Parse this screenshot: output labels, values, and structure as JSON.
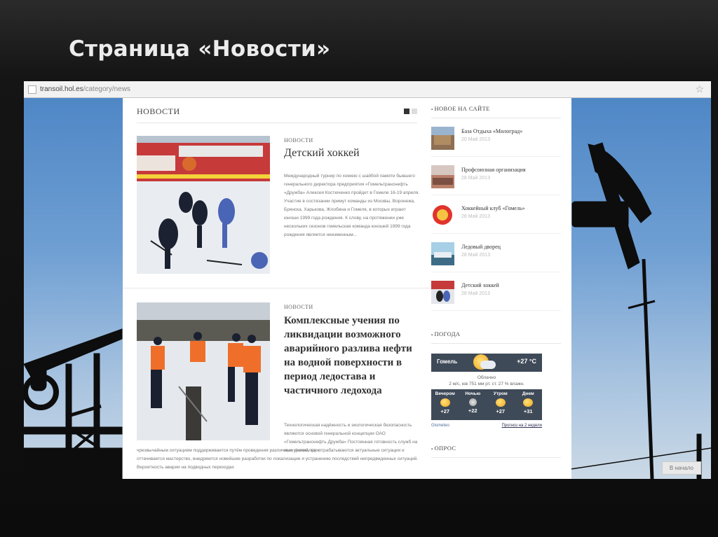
{
  "slide": {
    "title": "Страница «Новости»"
  },
  "browser": {
    "url_host": "transoil.hol.es",
    "url_path": "/category/news"
  },
  "page": {
    "section_title": "НОВОСТИ",
    "articles": [
      {
        "category": "НОВОСТИ",
        "title": "Детский хоккей",
        "excerpt": "Международный турнир по хоккею с шайбой памяти бывшего генерального директора предприятия «Гомельтранснефть «Дружба» Алексея Костюченко пройдет в Гомеле 16-19 апреля.  Участие в состязании примут команды из Москвы, Воронежа, Брянска, Харькова, Жлобина и Гомеля, в которых играют юноши 1999 года рождения. К слову, на протяжении уже нескольких сезонов гомельская команда юношей 1999 года рождения является неизменным..."
      },
      {
        "category": "НОВОСТИ",
        "title": "Комплексные учения по ликвидации возможного аварийного разлива нефти на водной поверхности в период ледостава и частичного ледохода",
        "excerpt": "Технологическая надёжность и экологическая безопасность являются основой генеральной концепции ОАО «Гомельтранснефть Дружба» Постоянная готовность служб на всех филиалах к",
        "excerpt_cont": "чрезвычайным ситуациям поддерживается путём проведения различных учений, где отрабатываются актуальные ситуации и оттачивается мастерство, внедряются новейшие разработки по локализации и устранению последствий непредвиденных ситуаций. Вероятность аварии на подводных переходах"
      }
    ]
  },
  "sidebar": {
    "new_on_site_title": "НОВОЕ НА САЙТЕ",
    "items": [
      {
        "title": "База Отдыха «Милоград»",
        "date": "20 Май 2013"
      },
      {
        "title": "Профсоюзная организация",
        "date": "28 Май 2013"
      },
      {
        "title": "Хоккейный клуб «Гомель»",
        "date": "28 Май 2013"
      },
      {
        "title": "Ледовый дворец",
        "date": "28 Май 2013"
      },
      {
        "title": "Детский хоккей",
        "date": "28 Май 2013"
      }
    ],
    "weather_title": "ПОГОДА",
    "weather": {
      "city": "Гомель",
      "temp": "+27 °C",
      "desc": "Облачно",
      "details": "2 м/с, юв   751 мм рт. ст.   27 % влажн.",
      "forecast": [
        {
          "label": "Вечером",
          "temp": "+27",
          "icon": "sun-cloud-icon"
        },
        {
          "label": "Ночью",
          "temp": "+22",
          "icon": "moon-icon"
        },
        {
          "label": "Утром",
          "temp": "+27",
          "icon": "sun-cloud-icon"
        },
        {
          "label": "Днем",
          "temp": "+31",
          "icon": "sun-cloud-icon"
        }
      ],
      "brand": "Gismeteo",
      "link": "Прогноз на 2 недели"
    },
    "poll_title": "ОПРОС"
  },
  "to_top": "В начало",
  "colors": {
    "weather_bg": "#3f4a58",
    "sky": "#4f87c6"
  }
}
